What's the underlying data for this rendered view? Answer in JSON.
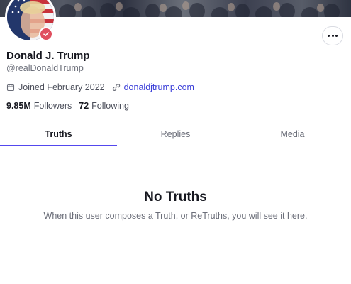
{
  "profile": {
    "display_name": "Donald J. Trump",
    "handle": "@realDonaldTrump",
    "joined": "Joined February 2022",
    "website": "donaldjtrump.com",
    "followers_count": "9.85M",
    "followers_label": "Followers",
    "following_count": "72",
    "following_label": "Following",
    "verified": true
  },
  "icons": {
    "more": "more-options-icon",
    "calendar": "calendar-icon",
    "link": "link-icon",
    "verified": "verified-badge-icon"
  },
  "tabs": [
    {
      "label": "Truths",
      "active": true
    },
    {
      "label": "Replies",
      "active": false
    },
    {
      "label": "Media",
      "active": false
    }
  ],
  "empty_state": {
    "title": "No Truths",
    "message": "When this user composes a Truth, or ReTruths, you will see it here."
  },
  "colors": {
    "accent": "#5448ee",
    "link": "#3b3fd8",
    "verified": "#e04f5f",
    "text_primary": "#16171f",
    "text_secondary": "#6b6e79"
  }
}
